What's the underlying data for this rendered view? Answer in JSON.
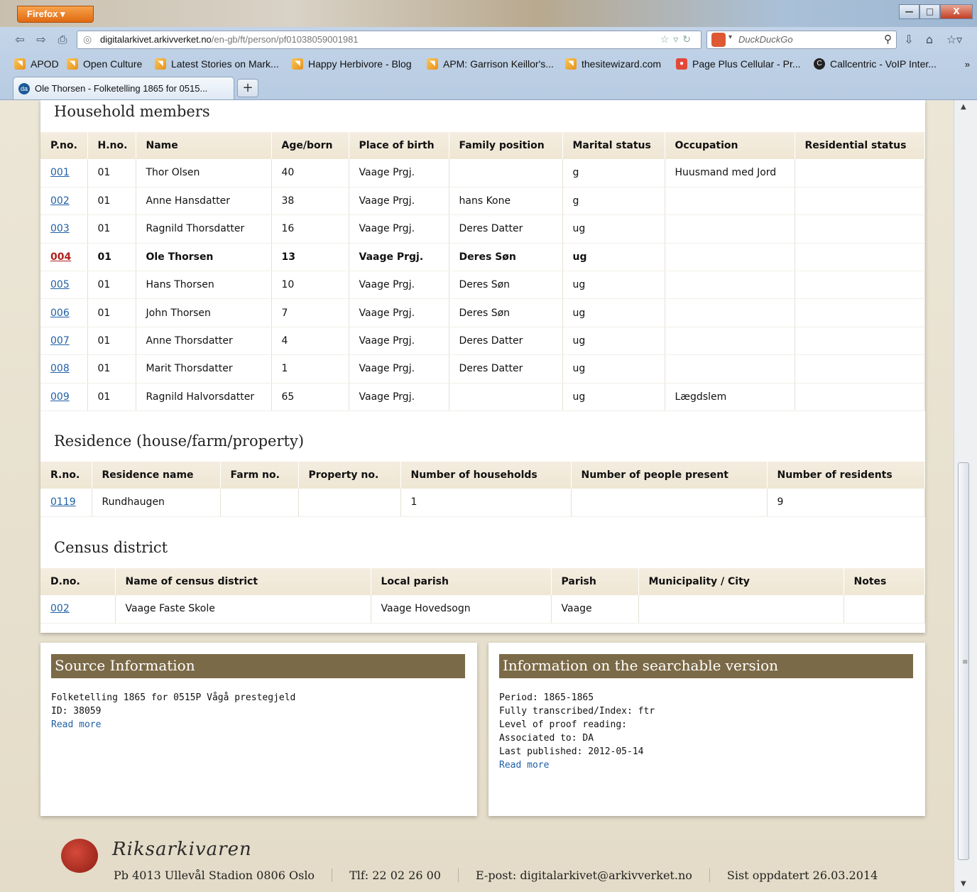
{
  "browser": {
    "app_button": "Firefox",
    "win_controls": {
      "minimize": "—",
      "maximize": "□",
      "close": "X"
    },
    "url": {
      "host": "digitalarkivet.arkivverket.no",
      "path": "/en-gb/ft/person/pf01038059001981"
    },
    "search_placeholder": "DuckDuckGo",
    "bookmarks": [
      {
        "label": "APOD"
      },
      {
        "label": "Open Culture"
      },
      {
        "label": "Latest Stories on Mark..."
      },
      {
        "label": "Happy Herbivore - Blog"
      },
      {
        "label": "APM: Garrison Keillor's..."
      },
      {
        "label": "thesitewizard.com"
      },
      {
        "label": "Page Plus Cellular - Pr..."
      },
      {
        "label": "Callcentric - VoIP Inter..."
      }
    ],
    "bookmarks_more": "»",
    "tab_title": "Ole Thorsen - Folketelling 1865 for 0515...",
    "tab_fav": "da",
    "new_tab": "+"
  },
  "household": {
    "title": "Household members",
    "columns": [
      "P.no.",
      "H.no.",
      "Name",
      "Age/born",
      "Place of birth",
      "Family position",
      "Marital status",
      "Occupation",
      "Residential status"
    ],
    "rows": [
      {
        "pno": "001",
        "hno": "01",
        "name": "Thor Olsen",
        "age": "40",
        "birth": "Vaage Prgj.",
        "position": "",
        "marital": "g",
        "occupation": "Huusmand med Jord",
        "residential": ""
      },
      {
        "pno": "002",
        "hno": "01",
        "name": "Anne Hansdatter",
        "age": "38",
        "birth": "Vaage Prgj.",
        "position": "hans Kone",
        "marital": "g",
        "occupation": "",
        "residential": ""
      },
      {
        "pno": "003",
        "hno": "01",
        "name": "Ragnild Thorsdatter",
        "age": "16",
        "birth": "Vaage Prgj.",
        "position": "Deres Datter",
        "marital": "ug",
        "occupation": "",
        "residential": ""
      },
      {
        "pno": "004",
        "hno": "01",
        "name": "Ole Thorsen",
        "age": "13",
        "birth": "Vaage Prgj.",
        "position": "Deres Søn",
        "marital": "ug",
        "occupation": "",
        "residential": ""
      },
      {
        "pno": "005",
        "hno": "01",
        "name": "Hans Thorsen",
        "age": "10",
        "birth": "Vaage Prgj.",
        "position": "Deres Søn",
        "marital": "ug",
        "occupation": "",
        "residential": ""
      },
      {
        "pno": "006",
        "hno": "01",
        "name": "John Thorsen",
        "age": "7",
        "birth": "Vaage Prgj.",
        "position": "Deres Søn",
        "marital": "ug",
        "occupation": "",
        "residential": ""
      },
      {
        "pno": "007",
        "hno": "01",
        "name": "Anne Thorsdatter",
        "age": "4",
        "birth": "Vaage Prgj.",
        "position": "Deres Datter",
        "marital": "ug",
        "occupation": "",
        "residential": ""
      },
      {
        "pno": "008",
        "hno": "01",
        "name": "Marit Thorsdatter",
        "age": "1",
        "birth": "Vaage Prgj.",
        "position": "Deres Datter",
        "marital": "ug",
        "occupation": "",
        "residential": ""
      },
      {
        "pno": "009",
        "hno": "01",
        "name": "Ragnild Halvorsdatter",
        "age": "65",
        "birth": "Vaage Prgj.",
        "position": "",
        "marital": "ug",
        "occupation": "Lægdslem",
        "residential": ""
      }
    ]
  },
  "residence": {
    "title": "Residence (house/farm/property)",
    "columns": [
      "R.no.",
      "Residence name",
      "Farm no.",
      "Property no.",
      "Number of households",
      "Number of people present",
      "Number of residents"
    ],
    "rows": [
      {
        "rno": "0119",
        "name": "Rundhaugen",
        "farm": "",
        "property": "",
        "households": "1",
        "present": "",
        "residents": "9"
      }
    ]
  },
  "census": {
    "title": "Census district",
    "columns": [
      "D.no.",
      "Name of census district",
      "Local parish",
      "Parish",
      "Municipality / City",
      "Notes"
    ],
    "rows": [
      {
        "dno": "002",
        "name": "Vaage Faste Skole",
        "local_parish": "Vaage Hovedsogn",
        "parish": "Vaage",
        "municipality": "",
        "notes": ""
      }
    ]
  },
  "source_info": {
    "title": "Source Information",
    "line1": "Folketelling 1865 for 0515P Vågå prestegjeld",
    "line2": "ID: 38059",
    "read_more": "Read more"
  },
  "searchable_info": {
    "title": "Information on the searchable version",
    "period": "Period: 1865-1865",
    "transcribed": "Fully transcribed/Index: ftr",
    "proof": "Level of proof reading:",
    "associated": "Associated to: DA",
    "published": "Last published: 2012-05-14",
    "read_more": "Read more"
  },
  "footer": {
    "brand": "Riksarkivaren",
    "address": "Pb 4013 Ullevål Stadion 0806 Oslo",
    "phone": "Tlf: 22 02 26 00",
    "email": "E-post: digitalarkivet@arkivverket.no",
    "updated": "Sist oppdatert 26.03.2014"
  }
}
